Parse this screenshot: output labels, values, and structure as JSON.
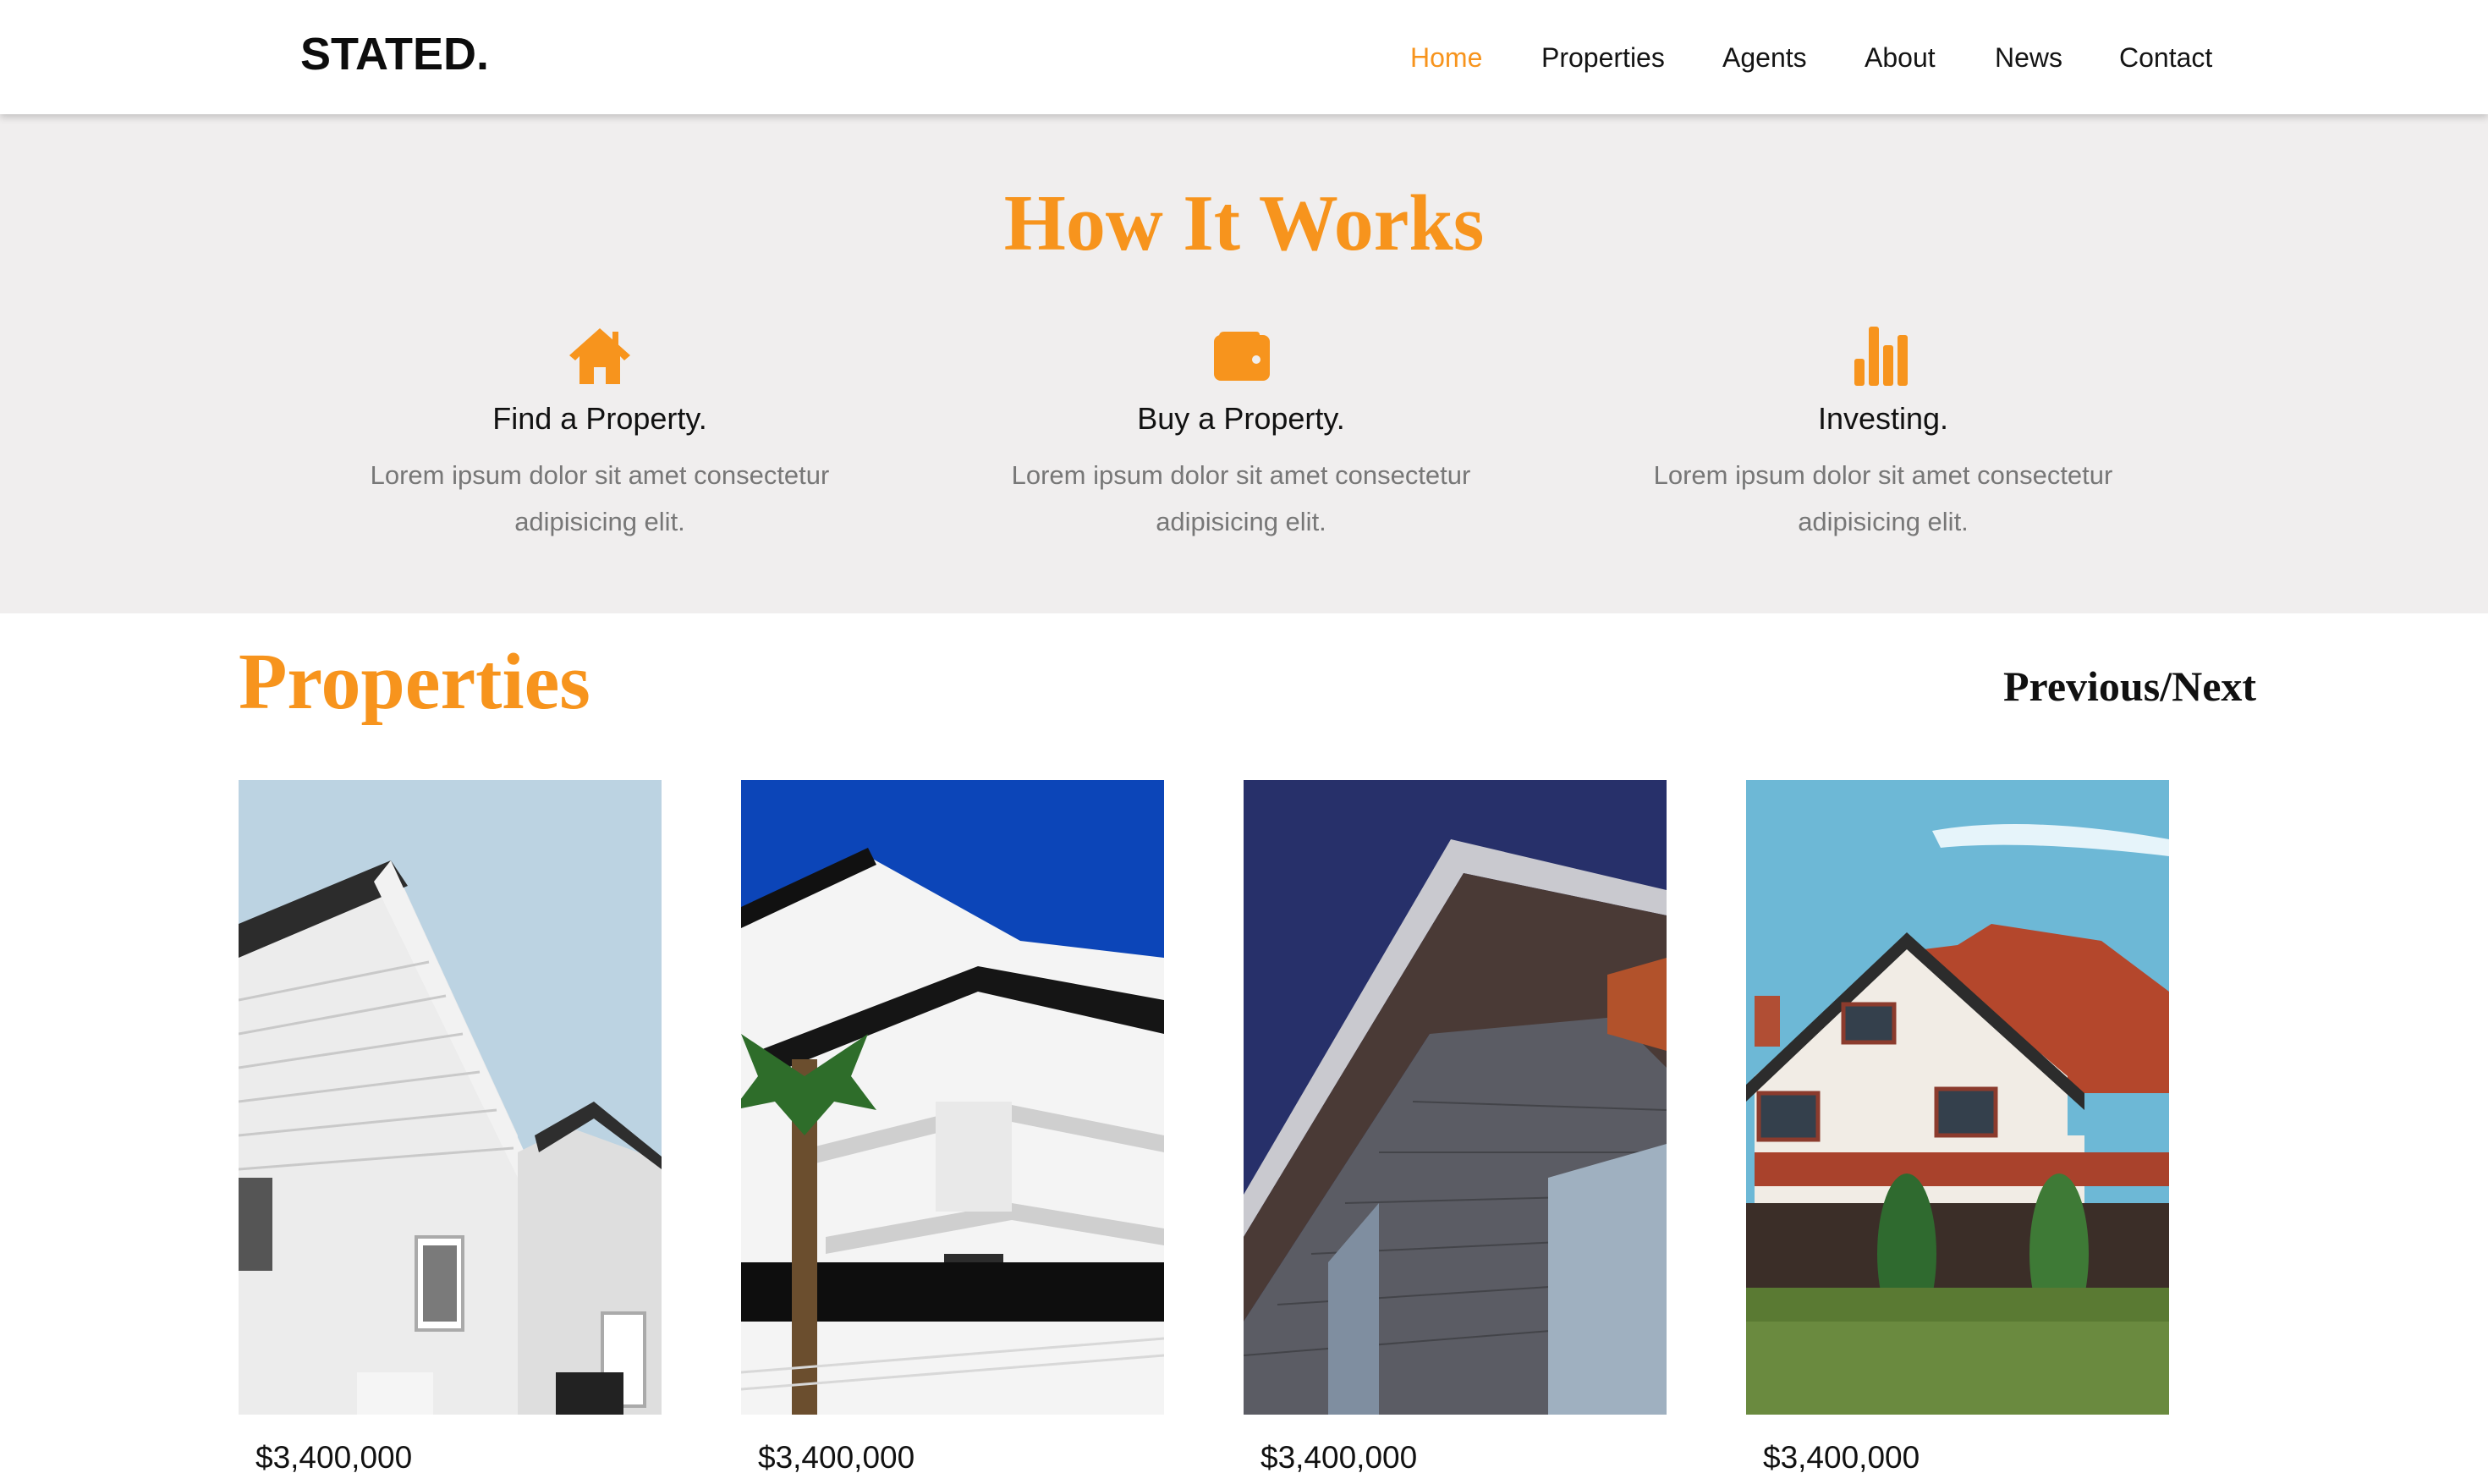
{
  "header": {
    "logo": "STATED.",
    "nav": [
      {
        "label": "Home",
        "active": true
      },
      {
        "label": "Properties",
        "active": false
      },
      {
        "label": "Agents",
        "active": false
      },
      {
        "label": "About",
        "active": false
      },
      {
        "label": "News",
        "active": false
      },
      {
        "label": "Contact",
        "active": false
      }
    ]
  },
  "how_it_works": {
    "title": "How It Works",
    "steps": [
      {
        "icon": "home-icon",
        "title": "Find a Property.",
        "text_line1": "Lorem ipsum dolor sit amet consectetur",
        "text_line2": "adipisicing elit."
      },
      {
        "icon": "wallet-icon",
        "title": "Buy a Property.",
        "text_line1": "Lorem ipsum dolor sit amet consectetur",
        "text_line2": "adipisicing elit."
      },
      {
        "icon": "bar-chart-icon",
        "title": "Investing.",
        "text_line1": "Lorem ipsum dolor sit amet consectetur",
        "text_line2": "adipisicing elit."
      }
    ]
  },
  "properties": {
    "title": "Properties",
    "previous_label": "Previous",
    "separator": "/",
    "next_label": "Next",
    "cards": [
      {
        "image": "white-wooden-house-photo",
        "price": "$3,400,000"
      },
      {
        "image": "white-apartment-building-photo",
        "price": "$3,400,000"
      },
      {
        "image": "modern-brick-building-photo",
        "price": "$3,400,000"
      },
      {
        "image": "tudor-style-house-photo",
        "price": "$3,400,000"
      }
    ]
  },
  "colors": {
    "accent": "#f7941d",
    "section_bg": "#f0eeee",
    "muted_text": "#777777"
  }
}
